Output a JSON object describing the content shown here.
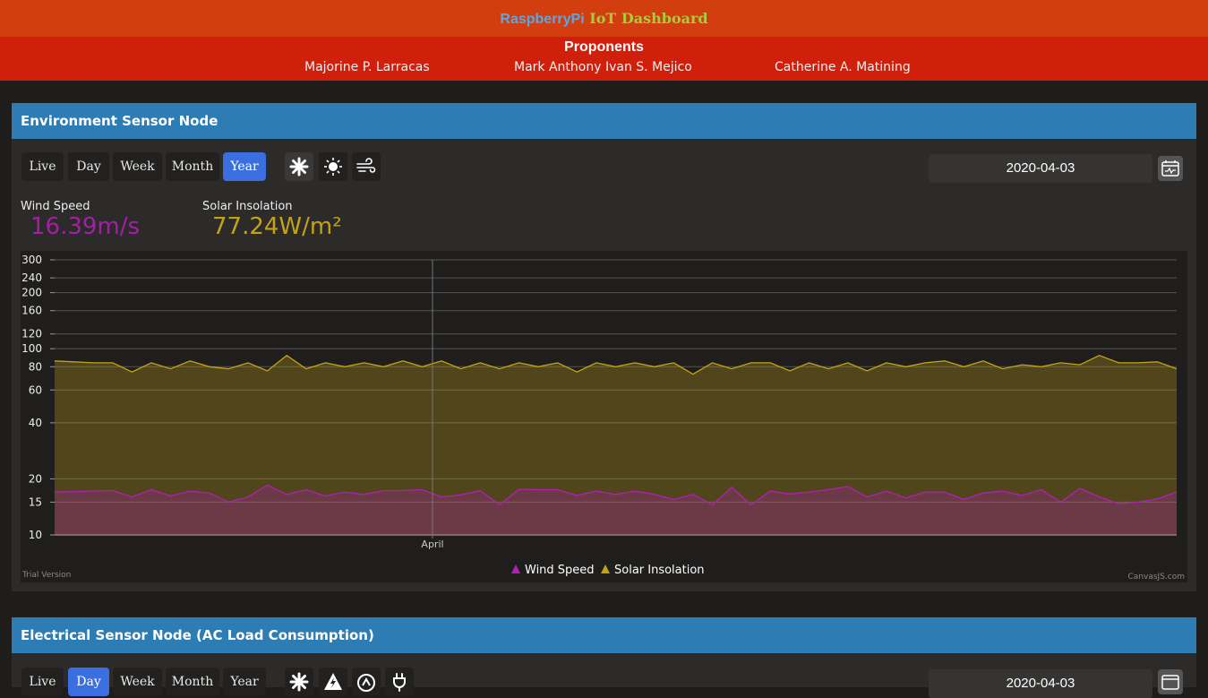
{
  "header": {
    "title_part1": "RaspberryPi",
    "title_part2": "IoT Dashboard"
  },
  "proponents": {
    "title": "Proponents",
    "names": [
      "Majorine P. Larracas",
      "Mark Anthony Ivan S. Mejico",
      "Catherine A. Matining"
    ]
  },
  "env_panel": {
    "title": "Environment Sensor Node",
    "range_buttons": [
      "Live",
      "Day",
      "Week",
      "Month",
      "Year"
    ],
    "active_range": "Year",
    "icon_buttons": [
      "wind-turbine-icon",
      "sun-icon",
      "wind-icon"
    ],
    "date": "2020-04-03",
    "stats": [
      {
        "label": "Wind Speed",
        "value": "16.39m/s",
        "color": "#a21fa6"
      },
      {
        "label": "Solar Insolation",
        "value": "77.24W/m²",
        "color": "#c4a216"
      }
    ],
    "chart_footer_left": "Trial Version",
    "chart_footer_right": "CanvasJS.com"
  },
  "elec_panel": {
    "title": "Electrical Sensor Node (AC Load Consumption)",
    "range_buttons": [
      "Live",
      "Day",
      "Week",
      "Month",
      "Year"
    ],
    "active_range": "Day",
    "icon_buttons": [
      "wind-turbine-icon",
      "lightning-icon",
      "gauge-icon",
      "plug-icon"
    ],
    "date": "2020-04-03"
  },
  "chart_data": {
    "type": "area",
    "xlabel": "",
    "ylabel": "",
    "y_scale": "log",
    "ylim": [
      10,
      300
    ],
    "y_ticks": [
      10,
      15,
      20,
      40,
      60,
      80,
      100,
      120,
      160,
      200,
      240,
      300
    ],
    "x_tick_labels": [
      "April"
    ],
    "legend_position": "bottom-center",
    "series": [
      {
        "name": "Wind Speed",
        "color": "#b21fb6",
        "values": [
          17,
          17.1,
          17.2,
          17.3,
          16.0,
          17.5,
          16.2,
          17.2,
          16.8,
          15.0,
          16.0,
          18.5,
          16.5,
          17.5,
          16.2,
          17.0,
          16.5,
          17.3,
          17.3,
          17.5,
          16.0,
          16.4,
          17.3,
          14.5,
          17.6,
          17.5,
          17.5,
          16.3,
          17.2,
          16.5,
          17.2,
          16.5,
          15.5,
          16.5,
          14.5,
          18.0,
          14.5,
          17.2,
          16.6,
          17.0,
          17.5,
          18.2,
          16.0,
          17.2,
          15.8,
          17.0,
          17.0,
          15.5,
          16.8,
          17.2,
          16.3,
          17.5,
          15.0,
          17.8,
          16.0,
          14.7,
          15.0,
          15.6,
          17.0
        ]
      },
      {
        "name": "Solar Insolation",
        "color": "#c4a216",
        "values": [
          86,
          85,
          84,
          84,
          75,
          84,
          78,
          86,
          80,
          78,
          84,
          76,
          92,
          78,
          84,
          80,
          84,
          80,
          86,
          80,
          86,
          78,
          84,
          78,
          84,
          80,
          84,
          75,
          84,
          80,
          84,
          80,
          84,
          73,
          84,
          78,
          84,
          84,
          76,
          84,
          78,
          84,
          76,
          84,
          80,
          84,
          86,
          80,
          86,
          78,
          82,
          80,
          84,
          82,
          92,
          84,
          84,
          85,
          78
        ]
      }
    ]
  }
}
